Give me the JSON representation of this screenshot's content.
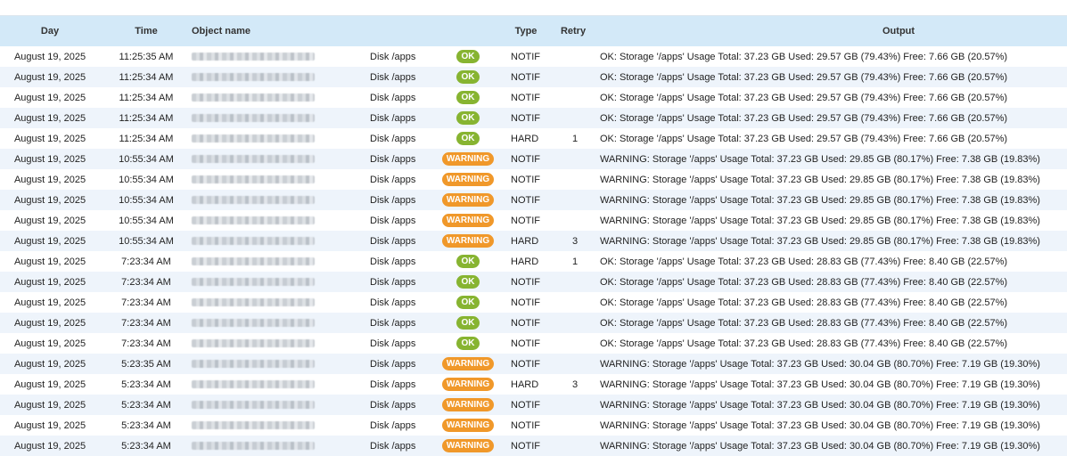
{
  "colors": {
    "header_bg": "#d3e9f8",
    "ok": "#87b431",
    "warning": "#f0982a",
    "row_alt": "#eef4fb"
  },
  "columns": {
    "day": "Day",
    "time": "Time",
    "object": "Object name",
    "type": "Type",
    "retry": "Retry",
    "output": "Output"
  },
  "rows": [
    {
      "day": "August 19, 2025",
      "time": "11:25:35 AM",
      "service": "Disk /apps",
      "status": "OK",
      "type": "NOTIF",
      "retry": "",
      "output": "OK: Storage '/apps' Usage Total: 37.23 GB Used: 29.57 GB (79.43%) Free: 7.66 GB (20.57%)"
    },
    {
      "day": "August 19, 2025",
      "time": "11:25:34 AM",
      "service": "Disk /apps",
      "status": "OK",
      "type": "NOTIF",
      "retry": "",
      "output": "OK: Storage '/apps' Usage Total: 37.23 GB Used: 29.57 GB (79.43%) Free: 7.66 GB (20.57%)"
    },
    {
      "day": "August 19, 2025",
      "time": "11:25:34 AM",
      "service": "Disk /apps",
      "status": "OK",
      "type": "NOTIF",
      "retry": "",
      "output": "OK: Storage '/apps' Usage Total: 37.23 GB Used: 29.57 GB (79.43%) Free: 7.66 GB (20.57%)"
    },
    {
      "day": "August 19, 2025",
      "time": "11:25:34 AM",
      "service": "Disk /apps",
      "status": "OK",
      "type": "NOTIF",
      "retry": "",
      "output": "OK: Storage '/apps' Usage Total: 37.23 GB Used: 29.57 GB (79.43%) Free: 7.66 GB (20.57%)"
    },
    {
      "day": "August 19, 2025",
      "time": "11:25:34 AM",
      "service": "Disk /apps",
      "status": "OK",
      "type": "HARD",
      "retry": "1",
      "output": "OK: Storage '/apps' Usage Total: 37.23 GB Used: 29.57 GB (79.43%) Free: 7.66 GB (20.57%)"
    },
    {
      "day": "August 19, 2025",
      "time": "10:55:34 AM",
      "service": "Disk /apps",
      "status": "WARNING",
      "type": "NOTIF",
      "retry": "",
      "output": "WARNING: Storage '/apps' Usage Total: 37.23 GB Used: 29.85 GB (80.17%) Free: 7.38 GB (19.83%)"
    },
    {
      "day": "August 19, 2025",
      "time": "10:55:34 AM",
      "service": "Disk /apps",
      "status": "WARNING",
      "type": "NOTIF",
      "retry": "",
      "output": "WARNING: Storage '/apps' Usage Total: 37.23 GB Used: 29.85 GB (80.17%) Free: 7.38 GB (19.83%)"
    },
    {
      "day": "August 19, 2025",
      "time": "10:55:34 AM",
      "service": "Disk /apps",
      "status": "WARNING",
      "type": "NOTIF",
      "retry": "",
      "output": "WARNING: Storage '/apps' Usage Total: 37.23 GB Used: 29.85 GB (80.17%) Free: 7.38 GB (19.83%)"
    },
    {
      "day": "August 19, 2025",
      "time": "10:55:34 AM",
      "service": "Disk /apps",
      "status": "WARNING",
      "type": "NOTIF",
      "retry": "",
      "output": "WARNING: Storage '/apps' Usage Total: 37.23 GB Used: 29.85 GB (80.17%) Free: 7.38 GB (19.83%)"
    },
    {
      "day": "August 19, 2025",
      "time": "10:55:34 AM",
      "service": "Disk /apps",
      "status": "WARNING",
      "type": "HARD",
      "retry": "3",
      "output": "WARNING: Storage '/apps' Usage Total: 37.23 GB Used: 29.85 GB (80.17%) Free: 7.38 GB (19.83%)"
    },
    {
      "day": "August 19, 2025",
      "time": "7:23:34 AM",
      "service": "Disk /apps",
      "status": "OK",
      "type": "HARD",
      "retry": "1",
      "output": "OK: Storage '/apps' Usage Total: 37.23 GB Used: 28.83 GB (77.43%) Free: 8.40 GB (22.57%)"
    },
    {
      "day": "August 19, 2025",
      "time": "7:23:34 AM",
      "service": "Disk /apps",
      "status": "OK",
      "type": "NOTIF",
      "retry": "",
      "output": "OK: Storage '/apps' Usage Total: 37.23 GB Used: 28.83 GB (77.43%) Free: 8.40 GB (22.57%)"
    },
    {
      "day": "August 19, 2025",
      "time": "7:23:34 AM",
      "service": "Disk /apps",
      "status": "OK",
      "type": "NOTIF",
      "retry": "",
      "output": "OK: Storage '/apps' Usage Total: 37.23 GB Used: 28.83 GB (77.43%) Free: 8.40 GB (22.57%)"
    },
    {
      "day": "August 19, 2025",
      "time": "7:23:34 AM",
      "service": "Disk /apps",
      "status": "OK",
      "type": "NOTIF",
      "retry": "",
      "output": "OK: Storage '/apps' Usage Total: 37.23 GB Used: 28.83 GB (77.43%) Free: 8.40 GB (22.57%)"
    },
    {
      "day": "August 19, 2025",
      "time": "7:23:34 AM",
      "service": "Disk /apps",
      "status": "OK",
      "type": "NOTIF",
      "retry": "",
      "output": "OK: Storage '/apps' Usage Total: 37.23 GB Used: 28.83 GB (77.43%) Free: 8.40 GB (22.57%)"
    },
    {
      "day": "August 19, 2025",
      "time": "5:23:35 AM",
      "service": "Disk /apps",
      "status": "WARNING",
      "type": "NOTIF",
      "retry": "",
      "output": "WARNING: Storage '/apps' Usage Total: 37.23 GB Used: 30.04 GB (80.70%) Free: 7.19 GB (19.30%)"
    },
    {
      "day": "August 19, 2025",
      "time": "5:23:34 AM",
      "service": "Disk /apps",
      "status": "WARNING",
      "type": "HARD",
      "retry": "3",
      "output": "WARNING: Storage '/apps' Usage Total: 37.23 GB Used: 30.04 GB (80.70%) Free: 7.19 GB (19.30%)"
    },
    {
      "day": "August 19, 2025",
      "time": "5:23:34 AM",
      "service": "Disk /apps",
      "status": "WARNING",
      "type": "NOTIF",
      "retry": "",
      "output": "WARNING: Storage '/apps' Usage Total: 37.23 GB Used: 30.04 GB (80.70%) Free: 7.19 GB (19.30%)"
    },
    {
      "day": "August 19, 2025",
      "time": "5:23:34 AM",
      "service": "Disk /apps",
      "status": "WARNING",
      "type": "NOTIF",
      "retry": "",
      "output": "WARNING: Storage '/apps' Usage Total: 37.23 GB Used: 30.04 GB (80.70%) Free: 7.19 GB (19.30%)"
    },
    {
      "day": "August 19, 2025",
      "time": "5:23:34 AM",
      "service": "Disk /apps",
      "status": "WARNING",
      "type": "NOTIF",
      "retry": "",
      "output": "WARNING: Storage '/apps' Usage Total: 37.23 GB Used: 30.04 GB (80.70%) Free: 7.19 GB (19.30%)"
    }
  ]
}
